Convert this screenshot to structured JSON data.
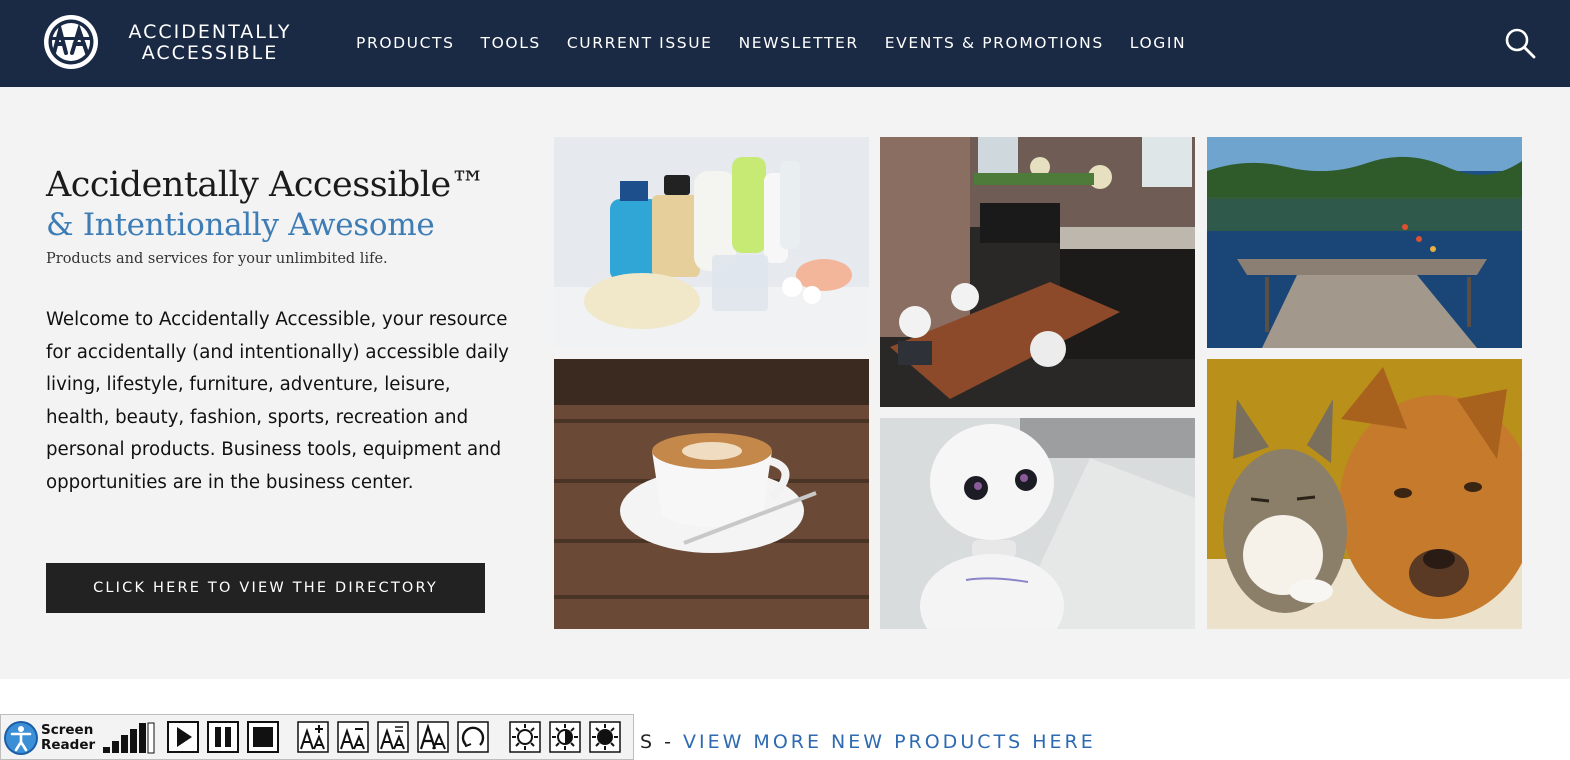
{
  "header": {
    "logo_line1": "ACCIDENTALLY",
    "logo_line2": "ACCESSIBLE",
    "nav": [
      "PRODUCTS",
      "TOOLS",
      "CURRENT ISSUE",
      "NEWSLETTER",
      "EVENTS & PROMOTIONS",
      "LOGIN"
    ]
  },
  "hero": {
    "title": "Accidentally Accessible™",
    "subtitle": "& Intentionally Awesome",
    "tagline": "Products and services for your unlimbited life.",
    "body": "Welcome to Accidentally Accessible, your resource for accidentally (and intentionally) accessible daily living, lifestyle, furniture, adventure, leisure, health, beauty, fashion, sports, recreation and personal products. Business tools, equipment and opportunities are in the business center.",
    "cta_label": "CLICK HERE TO VIEW THE DIRECTORY"
  },
  "more": {
    "prefix": "S - ",
    "link": "VIEW MORE NEW PRODUCTS HERE"
  },
  "screen_reader": {
    "label_line1": "Screen",
    "label_line2": "Reader"
  },
  "colors": {
    "header_bg": "#1a2944",
    "accent_blue": "#3d7cb5",
    "link_blue": "#2e6ab2",
    "cta_bg": "#222222"
  }
}
